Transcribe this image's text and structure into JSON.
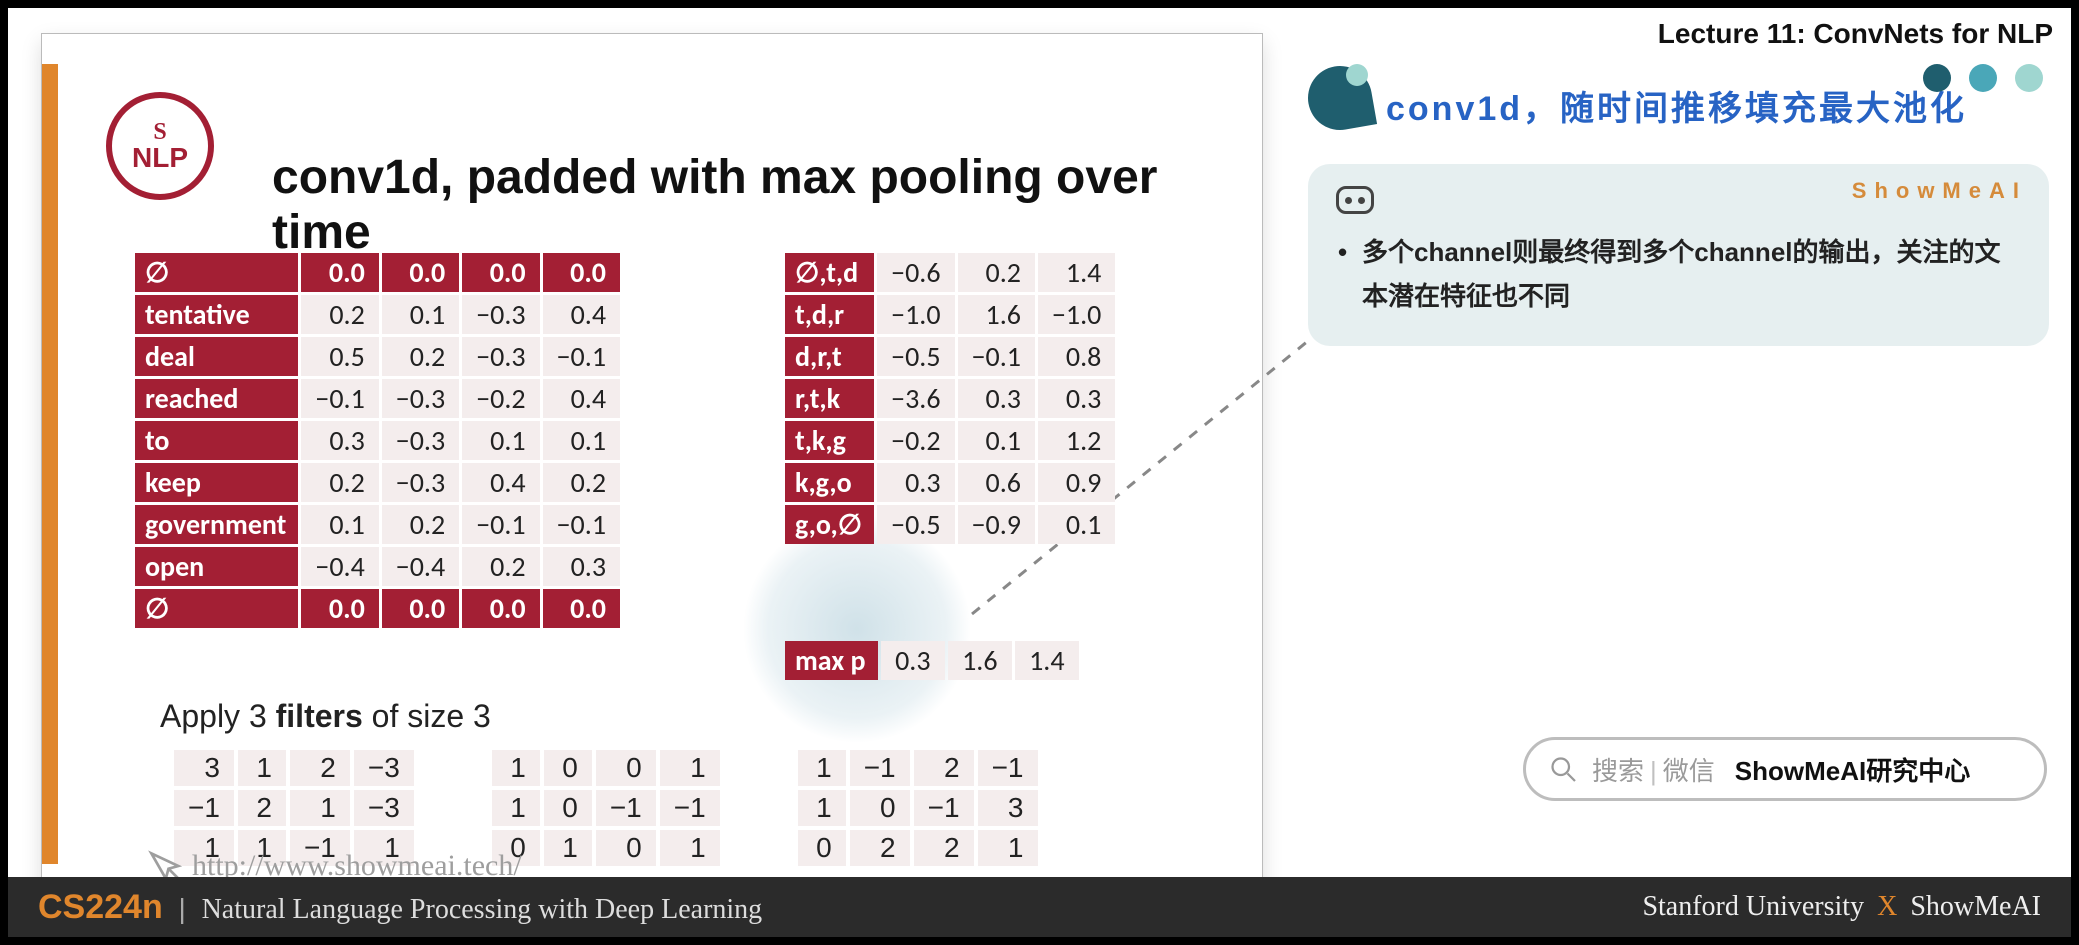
{
  "header": {
    "lecture": "Lecture 11: ConvNets for NLP"
  },
  "slide": {
    "logo_top": "S",
    "logo_bottom": "NLP",
    "title": "conv1d, padded with max pooling over time",
    "pad_symbol": "∅",
    "left_table": {
      "rows": [
        {
          "label": "∅",
          "vals": [
            "0.0",
            "0.0",
            "0.0",
            "0.0"
          ],
          "pad": true
        },
        {
          "label": "tentative",
          "vals": [
            "0.2",
            "0.1",
            "−0.3",
            "0.4"
          ]
        },
        {
          "label": "deal",
          "vals": [
            "0.5",
            "0.2",
            "−0.3",
            "−0.1"
          ]
        },
        {
          "label": "reached",
          "vals": [
            "−0.1",
            "−0.3",
            "−0.2",
            "0.4"
          ]
        },
        {
          "label": "to",
          "vals": [
            "0.3",
            "−0.3",
            "0.1",
            "0.1"
          ]
        },
        {
          "label": "keep",
          "vals": [
            "0.2",
            "−0.3",
            "0.4",
            "0.2"
          ]
        },
        {
          "label": "government",
          "vals": [
            "0.1",
            "0.2",
            "−0.1",
            "−0.1"
          ]
        },
        {
          "label": "open",
          "vals": [
            "−0.4",
            "−0.4",
            "0.2",
            "0.3"
          ]
        },
        {
          "label": "∅",
          "vals": [
            "0.0",
            "0.0",
            "0.0",
            "0.0"
          ],
          "pad": true
        }
      ]
    },
    "right_table": {
      "rows": [
        {
          "label": "∅,t,d",
          "vals": [
            "−0.6",
            "0.2",
            "1.4"
          ]
        },
        {
          "label": "t,d,r",
          "vals": [
            "−1.0",
            "1.6",
            "−1.0"
          ]
        },
        {
          "label": "d,r,t",
          "vals": [
            "−0.5",
            "−0.1",
            "0.8"
          ]
        },
        {
          "label": "r,t,k",
          "vals": [
            "−3.6",
            "0.3",
            "0.3"
          ]
        },
        {
          "label": "t,k,g",
          "vals": [
            "−0.2",
            "0.1",
            "1.2"
          ]
        },
        {
          "label": "k,g,o",
          "vals": [
            "0.3",
            "0.6",
            "0.9"
          ]
        },
        {
          "label": "g,o,∅",
          "vals": [
            "−0.5",
            "−0.9",
            "0.1"
          ]
        }
      ]
    },
    "maxp": {
      "label": "max p",
      "vals": [
        "0.3",
        "1.6",
        "1.4"
      ]
    },
    "apply_prefix": "Apply 3 ",
    "apply_bold": "filters",
    "apply_suffix": " of size 3",
    "filters": [
      [
        [
          "3",
          "1",
          "2",
          "−3"
        ],
        [
          "−1",
          "2",
          "1",
          "−3"
        ],
        [
          "1",
          "1",
          "−1",
          "1"
        ]
      ],
      [
        [
          "1",
          "0",
          "0",
          "1"
        ],
        [
          "1",
          "0",
          "−1",
          "−1"
        ],
        [
          "0",
          "1",
          "0",
          "1"
        ]
      ],
      [
        [
          "1",
          "−1",
          "2",
          "−1"
        ],
        [
          "1",
          "0",
          "−1",
          "3"
        ],
        [
          "0",
          "2",
          "2",
          "1"
        ]
      ]
    ],
    "watermark": "http://www.showmeai.tech/"
  },
  "right_panel": {
    "title": "conv1d，随时间推移填充最大池化",
    "brand": "ShowMeAI",
    "bullets": [
      "多个channel则最终得到多个channel的输出，关注的文本潜在特征也不同"
    ]
  },
  "search": {
    "ph_a": "搜索",
    "ph_b": "微信",
    "strong": "ShowMeAI研究中心"
  },
  "footer": {
    "course": "CS224n",
    "subtitle": "Natural Language Processing with Deep Learning",
    "uni": "Stanford University",
    "brand": "ShowMeAI"
  }
}
